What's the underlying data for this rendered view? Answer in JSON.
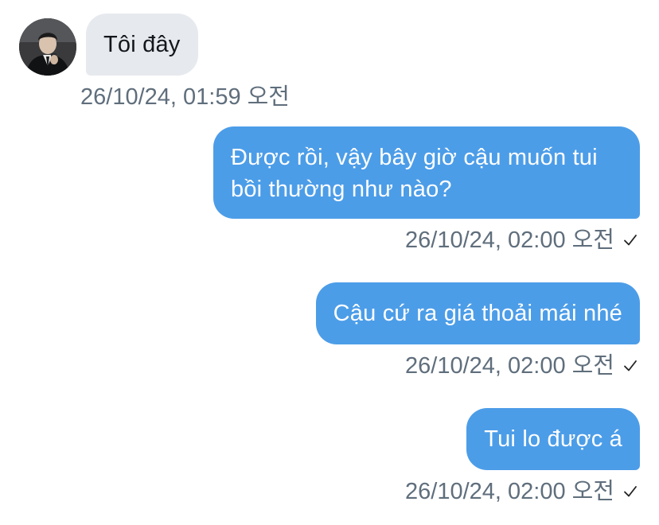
{
  "messages": [
    {
      "direction": "incoming",
      "text": "Tôi đây",
      "timestamp": "26/10/24, 01:59 오전",
      "has_avatar": true
    },
    {
      "direction": "outgoing",
      "text": "Được rồi, vậy bây giờ cậu muốn tui bồi thường như nào?",
      "timestamp": "26/10/24, 02:00 오전",
      "status_icon": "checkmark-icon"
    },
    {
      "direction": "outgoing",
      "text": "Cậu cứ ra giá thoải mái nhé",
      "timestamp": "26/10/24, 02:00 오전",
      "status_icon": "checkmark-icon"
    },
    {
      "direction": "outgoing",
      "text": "Tui lo được á",
      "timestamp": "26/10/24, 02:00 오전",
      "status_icon": "checkmark-icon"
    }
  ],
  "colors": {
    "outgoing_bubble": "#4c9de8",
    "incoming_bubble": "#e6e9ee",
    "timestamp_text": "#5f6e7c"
  }
}
